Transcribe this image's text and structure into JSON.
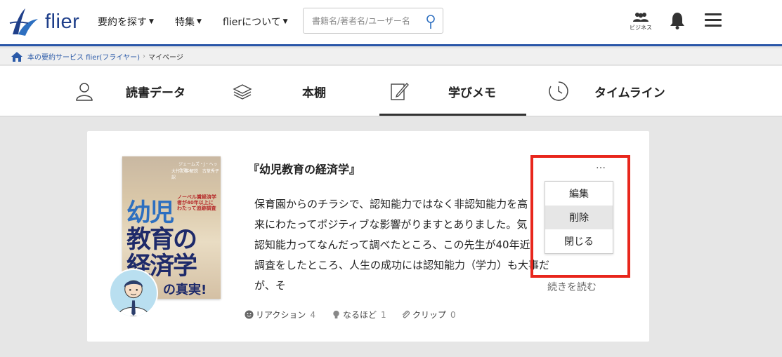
{
  "header": {
    "logo_text": "flier",
    "nav": [
      {
        "label": "要約を探す"
      },
      {
        "label": "特集"
      },
      {
        "label": "flierについて"
      }
    ],
    "search_placeholder": "書籍名/著者名/ユーザー名",
    "business_label": "ビジネス",
    "brand_color": "#2a56a8"
  },
  "breadcrumb": {
    "home": "本の要約サービス flier(フライヤー)",
    "current": "マイページ"
  },
  "tabs": [
    {
      "label": "読書データ",
      "icon": "person-icon"
    },
    {
      "label": "本棚",
      "icon": "books-icon"
    },
    {
      "label": "学びメモ",
      "icon": "notebook-pen-icon",
      "active": true
    },
    {
      "label": "タイムライン",
      "icon": "clock-icon"
    }
  ],
  "memo": {
    "title": "『幼児教育の経済学』",
    "lines": [
      "保育園からのチラシで、認知能力ではなく非認知能力を高",
      "来にわたってポジティブな影響がりますとありました。気",
      "認知能力ってなんだって調べたところ、この先生が40年近",
      "調査をしたところ、人生の成功には認知能力（学力）も大事だが、そ"
    ],
    "read_more": "続きを読む",
    "reaction_label": "リアクション",
    "reaction_count": "4",
    "naruhodo_label": "なるほど",
    "naruhodo_count": "1",
    "clip_label": "クリップ",
    "clip_count": "0",
    "more_glyph": "…"
  },
  "book": {
    "author": "ジェームズ・J・ヘックマン",
    "translator": "大竹文雄 解説　古草秀子 訳",
    "badge": "ノーベル賞経済学者が40年以上にわたって追跡調査",
    "title_line1": "幼児",
    "title_line2": "教育の",
    "title_line3": "経済学",
    "bottom": "の真実!"
  },
  "menu": {
    "items": [
      "編集",
      "削除",
      "閉じる"
    ],
    "active_index": 1
  }
}
